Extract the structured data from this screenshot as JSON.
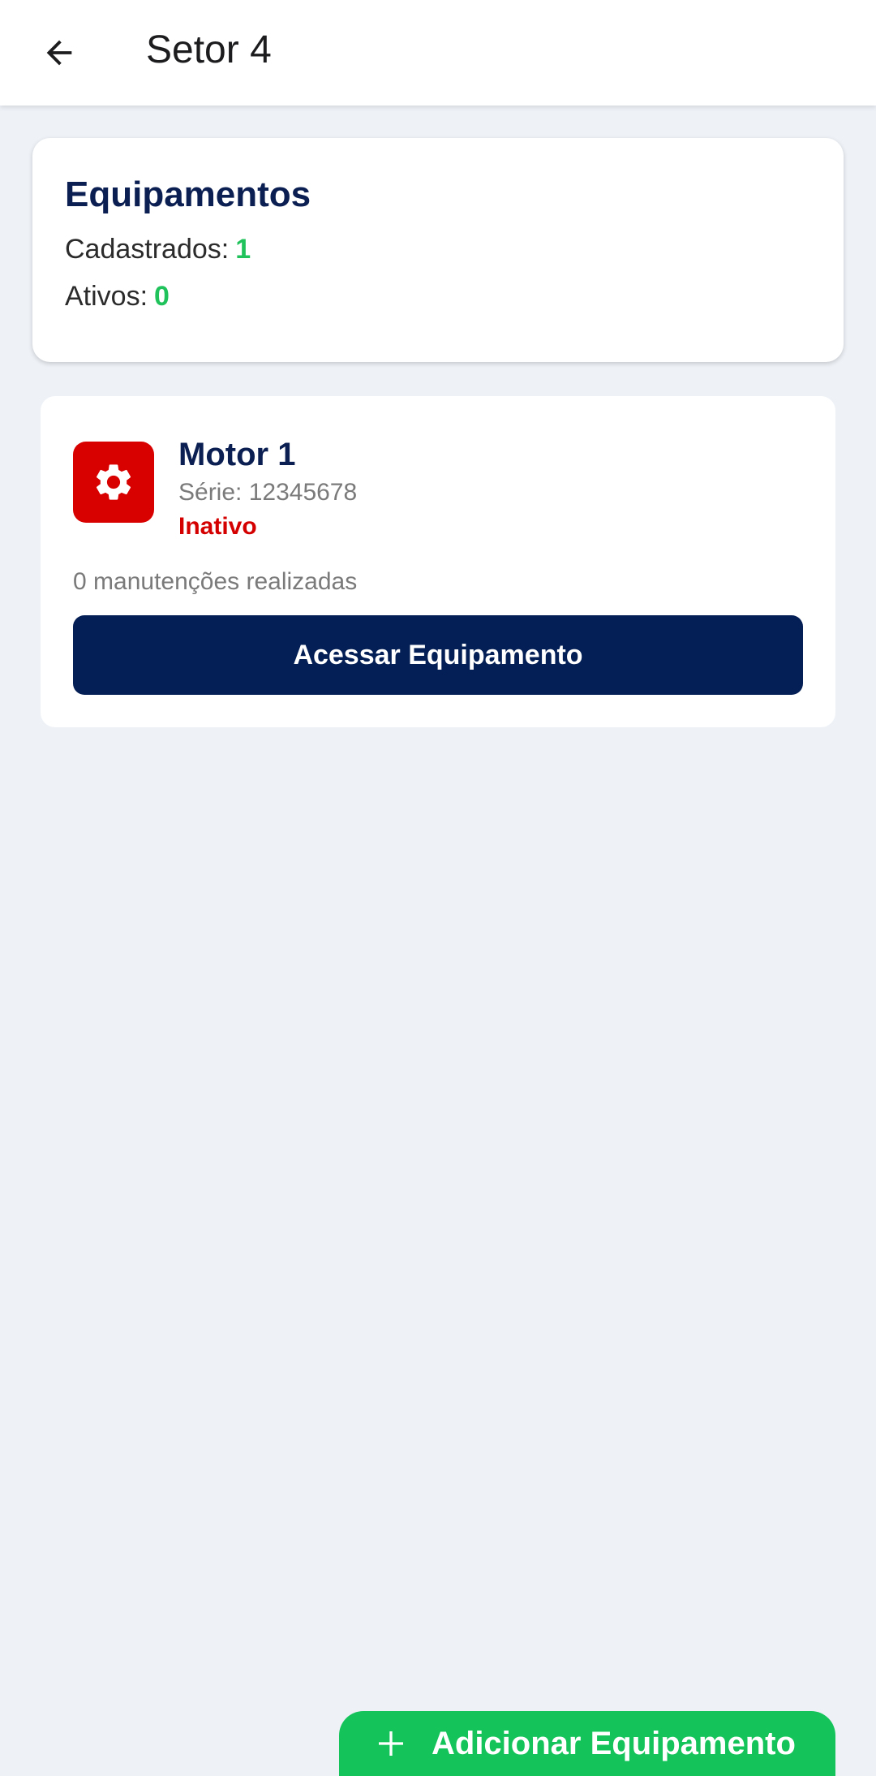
{
  "header": {
    "title": "Setor 4",
    "back_icon": "arrow-left-icon"
  },
  "summary": {
    "title": "Equipamentos",
    "registered_label": "Cadastrados:",
    "registered_value": "1",
    "active_label": "Ativos:",
    "active_value": "0"
  },
  "equipment": [
    {
      "icon": "gear-icon",
      "name": "Motor 1",
      "serial": "Série: 12345678",
      "status": "Inativo",
      "maintenance": "0 manutenções realizadas",
      "access_label": "Acessar Equipamento"
    }
  ],
  "fab": {
    "icon": "plus-icon",
    "label": "Adicionar Equipamento"
  },
  "colors": {
    "brand_navy": "#041f55",
    "accent_green": "#14c45a",
    "status_red": "#d40000",
    "background": "#eef2f7"
  }
}
